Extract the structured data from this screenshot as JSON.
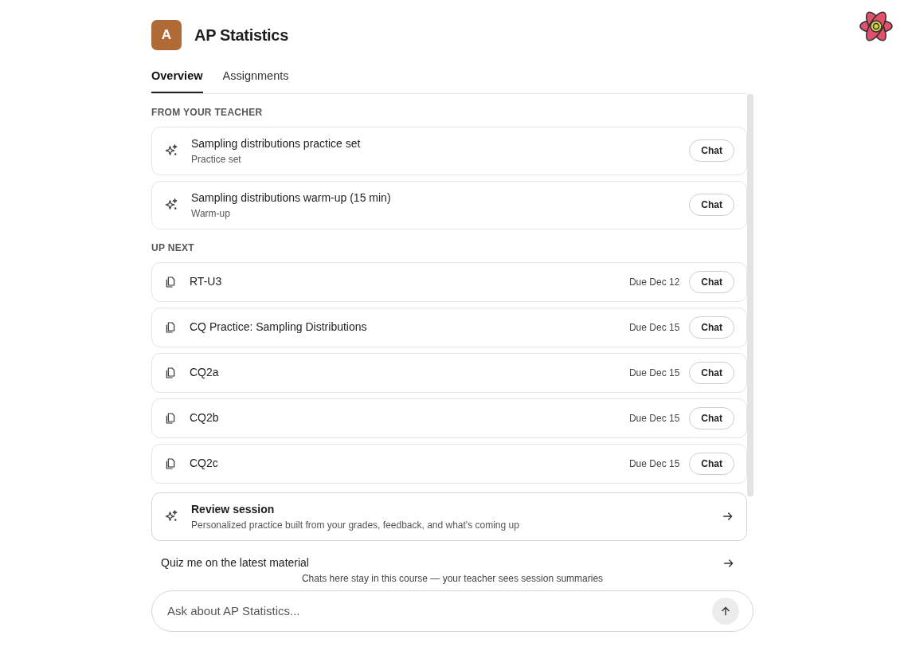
{
  "course": {
    "initial": "A",
    "title": "AP Statistics"
  },
  "tabs": [
    {
      "label": "Overview",
      "selected": true
    },
    {
      "label": "Assignments",
      "selected": false
    }
  ],
  "sections": [
    {
      "heading": "FROM YOUR TEACHER",
      "items": [
        {
          "kind": "sparkle",
          "title": "Sampling distributions practice set",
          "subtitle": "Practice set",
          "action": "Chat"
        },
        {
          "kind": "sparkle",
          "title": "Sampling distributions warm-up (15 min)",
          "subtitle": "Warm-up",
          "action": "Chat"
        }
      ]
    },
    {
      "heading": "UP NEXT",
      "items": [
        {
          "kind": "document",
          "title": "RT-U3",
          "due": "Due Dec 12",
          "action": "Chat"
        },
        {
          "kind": "document",
          "title": "CQ Practice: Sampling Distributions",
          "due": "Due Dec 15",
          "action": "Chat"
        },
        {
          "kind": "document",
          "title": "CQ2a",
          "due": "Due Dec 15",
          "action": "Chat"
        },
        {
          "kind": "document",
          "title": "CQ2b",
          "due": "Due Dec 15",
          "action": "Chat"
        },
        {
          "kind": "document",
          "title": "CQ2c",
          "due": "Due Dec 15",
          "action": "Chat"
        }
      ]
    }
  ],
  "review": {
    "title": "Review session",
    "subtitle": "Personalized practice built from your grades, feedback, and what's coming up"
  },
  "suggestions": [
    {
      "text": "Quiz me on the latest material"
    }
  ],
  "note": "Chats here stay in this course — your teacher sees session summaries",
  "composer": {
    "placeholder": "Ask about AP Statistics..."
  }
}
